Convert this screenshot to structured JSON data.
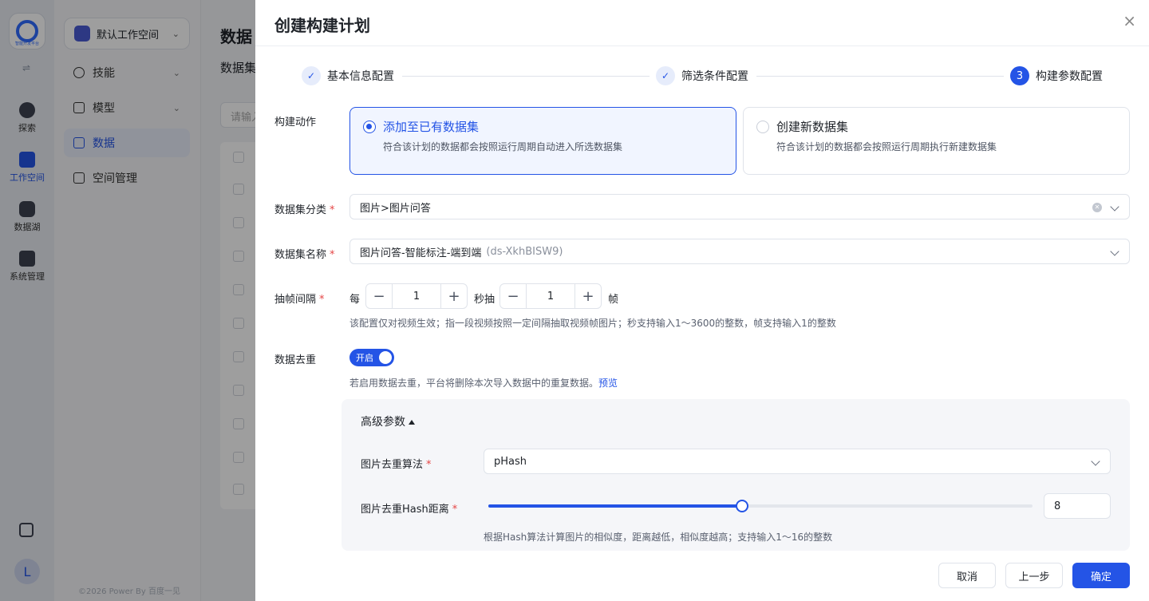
{
  "app": {
    "logo_text": "智能开发平台",
    "rail": [
      {
        "label": "探索"
      },
      {
        "label": "工作空间"
      },
      {
        "label": "数据湖"
      },
      {
        "label": "系统管理"
      }
    ],
    "avatar_letter": "L",
    "workspace": "默认工作空间",
    "sidebar": [
      {
        "label": "技能"
      },
      {
        "label": "模型"
      },
      {
        "label": "数据"
      },
      {
        "label": "空间管理"
      }
    ],
    "copyright": "©2026 Power By 百度一见",
    "main_title": "数据",
    "main_sub": "数据集",
    "search_placeholder": "请输入"
  },
  "drawer": {
    "title": "创建构建计划",
    "close_label": "×",
    "steps": [
      {
        "label": "基本信息配置",
        "state": "done",
        "mark": "✓"
      },
      {
        "label": "筛选条件配置",
        "state": "done",
        "mark": "✓"
      },
      {
        "label": "构建参数配置",
        "state": "current",
        "mark": "3"
      }
    ],
    "action": {
      "label": "构建动作",
      "options": [
        {
          "title": "添加至已有数据集",
          "desc": "符合该计划的数据都会按照运行周期自动进入所选数据集",
          "selected": true
        },
        {
          "title": "创建新数据集",
          "desc": "符合该计划的数据都会按照运行周期执行新建数据集",
          "selected": false
        }
      ]
    },
    "category": {
      "label": "数据集分类",
      "value": "图片>图片问答"
    },
    "dataset_name": {
      "label": "数据集名称",
      "value": "图片问答-智能标注-端到端",
      "id": "(ds-XkhBISW9)"
    },
    "frame_interval": {
      "label": "抽帧间隔",
      "prefix": "每",
      "seconds_value": "1",
      "middle": "秒抽",
      "frames_value": "1",
      "suffix": "帧",
      "minus": "−",
      "plus": "+",
      "hint": "该配置仅对视频生效；指一段视频按照一定间隔抽取视频帧图片；秒支持输入1～3600的整数，帧支持输入1的整数"
    },
    "dedup": {
      "label": "数据去重",
      "toggle_text": "开启",
      "enabled": true,
      "hint": "若启用数据去重，平台将删除本次导入数据中的重复数据。",
      "preview_link": "预览"
    },
    "advanced": {
      "title": "高级参数",
      "algo_label": "图片去重算法",
      "algo_value": "pHash",
      "hash_label": "图片去重Hash距离",
      "hash_value": "8",
      "hash_min": 1,
      "hash_max": 16,
      "hint": "根据Hash算法计算图片的相似度，距离越低，相似度越高；支持输入1～16的整数"
    },
    "buttons": {
      "cancel": "取消",
      "prev": "上一步",
      "confirm": "确定"
    }
  },
  "colors": {
    "primary": "#2454e6",
    "required": "#e54545"
  }
}
